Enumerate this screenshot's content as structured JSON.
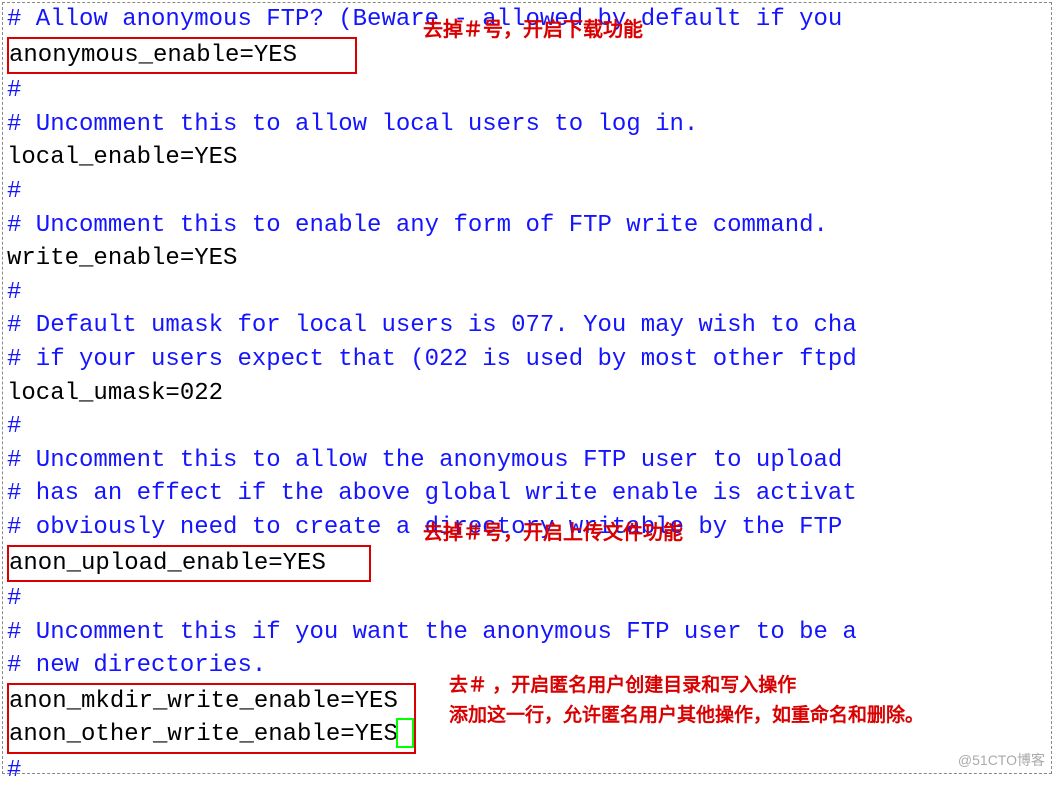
{
  "lines": {
    "l0": "# Allow anonymous FTP? (Beware - allowed by default if you",
    "l1": "anonymous_enable=YES",
    "l2": "#",
    "l3": "# Uncomment this to allow local users to log in.",
    "l4": "local_enable=YES",
    "l5": "#",
    "l6": "# Uncomment this to enable any form of FTP write command.",
    "l7": "write_enable=YES",
    "l8": "#",
    "l9": "# Default umask for local users is 077. You may wish to cha",
    "l10": "# if your users expect that (022 is used by most other ftpd",
    "l11": "local_umask=022",
    "l12": "#",
    "l13": "# Uncomment this to allow the anonymous FTP user to upload ",
    "l14": "# has an effect if the above global write enable is activat",
    "l15": "# obviously need to create a directory writable by the FTP ",
    "l16": "anon_upload_enable=YES",
    "l17": "#",
    "l18": "# Uncomment this if you want the anonymous FTP user to be a",
    "l19": "# new directories.",
    "l20": "anon_mkdir_write_enable=YES",
    "l21": "anon_other_write_enable=YES",
    "l22": "#"
  },
  "annotations": {
    "a1": "去掉＃号，开启下载功能",
    "a2": "去掉＃号，开启上传文件功能",
    "a3": "去＃ ，开启匿名用户创建目录和写入操作",
    "a4": "添加这一行，允许匿名用户其他操作，如重命名和删除。"
  },
  "watermark": "@51CTO博客"
}
